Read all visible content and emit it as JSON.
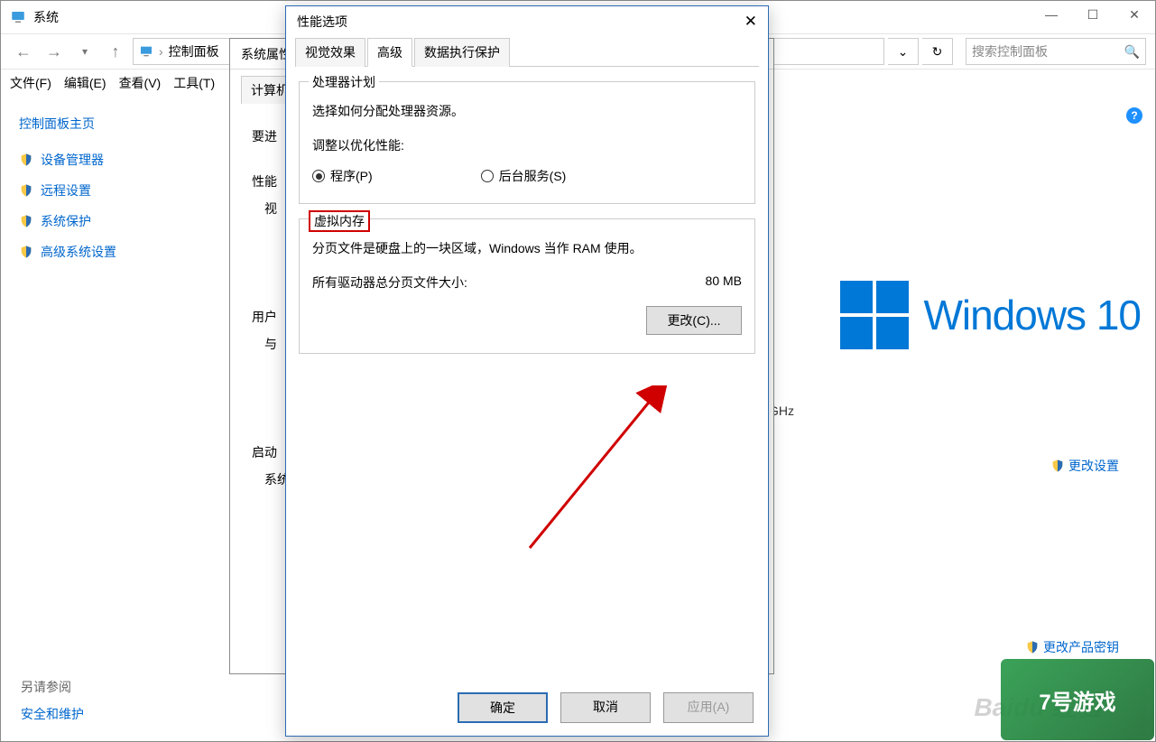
{
  "base_window": {
    "title": "系统",
    "breadcrumb": "控制面板",
    "search_placeholder": "搜索控制面板",
    "menus": {
      "file": "文件(F)",
      "edit": "编辑(E)",
      "view": "查看(V)",
      "tools": "工具(T)"
    },
    "sidebar": {
      "head": "控制面板主页",
      "items": [
        "设备管理器",
        "远程设置",
        "系统保护",
        "高级系统设置"
      ]
    },
    "seealso": {
      "head": "另请参阅",
      "link": "安全和维护"
    },
    "win10": "Windows 10",
    "ghz": "GHz",
    "change_settings": "更改设置",
    "change_product_key": "更改产品密钥"
  },
  "sysprop_dialog": {
    "title": "系统属性",
    "tab": "计算机",
    "line1": "要进",
    "line2": "性能",
    "line3": "视",
    "line4": "用户",
    "line5": "与",
    "line6": "启动",
    "line7": "系统"
  },
  "perf_dialog": {
    "title": "性能选项",
    "tabs": {
      "visual": "视觉效果",
      "advanced": "高级",
      "dep": "数据执行保护"
    },
    "group_cpu": {
      "legend": "处理器计划",
      "desc": "选择如何分配处理器资源。",
      "adjust": "调整以优化性能:",
      "radio_program": "程序(P)",
      "radio_service": "后台服务(S)"
    },
    "group_vm": {
      "legend": "虚拟内存",
      "desc": "分页文件是硬盘上的一块区域，Windows 当作 RAM 使用。",
      "size_label": "所有驱动器总分页文件大小:",
      "size_value": "80 MB",
      "change_btn": "更改(C)..."
    },
    "buttons": {
      "ok": "确定",
      "cancel": "取消",
      "apply": "应用(A)"
    }
  },
  "watermark": "Baidu 经验",
  "corner_logo": "7号游戏"
}
